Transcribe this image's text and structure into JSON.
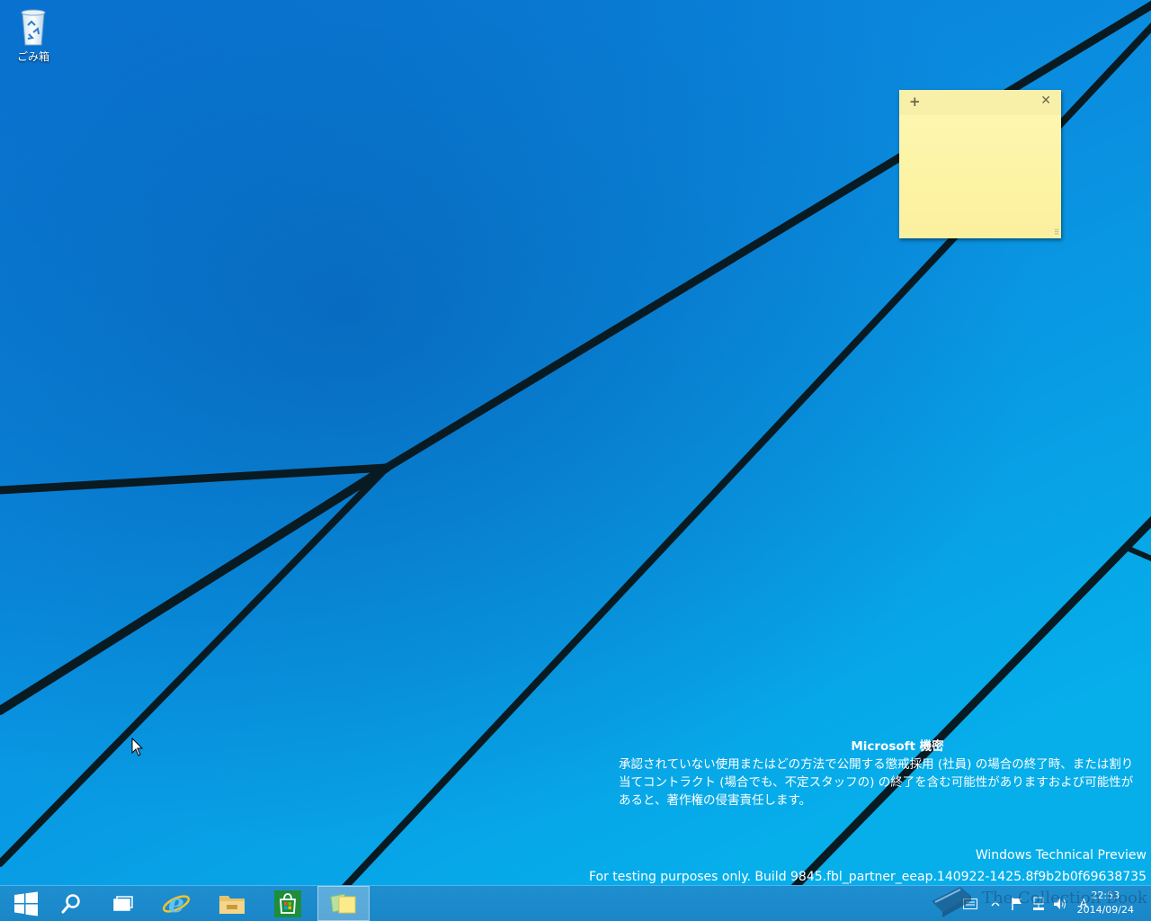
{
  "desktop": {
    "icons": [
      {
        "label": "ごみ箱",
        "icon": "recycle-bin-icon"
      }
    ]
  },
  "sticky_note": {
    "add_label": "+",
    "close_label": "✕",
    "text": ""
  },
  "watermark": {
    "title": "Microsoft 機密",
    "body": "承認されていない使用またはどの方法で公開する懲戒採用 (社員) の場合の終了時、または割り当てコントラクト (場合でも、不定スタッフの) の終了を含む可能性がありますおよび可能性があると、著作権の侵害責任します。"
  },
  "build_info": {
    "line1": "Windows Technical Preview",
    "line2": "For testing purposes only. Build 9845.fbl_partner_eeap.140922-1425.8f9b2b0f69638735"
  },
  "taskbar": {
    "buttons": [
      {
        "name": "start-button",
        "icon": "windows-logo-icon"
      },
      {
        "name": "search-button",
        "icon": "search-icon"
      },
      {
        "name": "task-view-button",
        "icon": "task-view-icon"
      },
      {
        "name": "internet-explorer-button",
        "icon": "internet-explorer-icon"
      },
      {
        "name": "file-explorer-button",
        "icon": "folder-icon"
      },
      {
        "name": "store-button",
        "icon": "store-icon"
      },
      {
        "name": "sticky-notes-button",
        "icon": "sticky-notes-icon",
        "active": true
      }
    ],
    "tray": {
      "ime_label": "A",
      "time": "22:53",
      "date": "2014/09/24"
    }
  },
  "overlay_logo": {
    "text": "The Collection Book"
  },
  "colors": {
    "taskbar": "#1a86c8",
    "wallpaper_top": "#0a6fd0",
    "wallpaper_bottom": "#0aa8e8",
    "sticky_note": "#fcf3a3"
  }
}
